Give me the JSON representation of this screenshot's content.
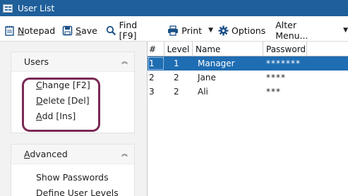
{
  "window": {
    "title": "User List"
  },
  "toolbar": {
    "notepad": {
      "prefix": "",
      "accel": "N",
      "rest": "otepad"
    },
    "save": {
      "prefix": "",
      "accel": "S",
      "rest": "ave"
    },
    "find": "Find [F9]",
    "print": "Print",
    "options": "Options",
    "alter_menu": "Alter Menu..."
  },
  "sidebar": {
    "users_panel": {
      "title": "Users",
      "items": [
        {
          "accel": "C",
          "rest": "hange [F2]"
        },
        {
          "accel": "D",
          "rest": "elete [Del]"
        },
        {
          "accel": "A",
          "rest": "dd [Ins]"
        }
      ]
    },
    "advanced_panel": {
      "title_accel": "A",
      "title_rest": "dvanced",
      "items": [
        "Show Passwords",
        "Define User Levels"
      ]
    }
  },
  "grid": {
    "columns": [
      "#",
      "Level",
      "Name",
      "Password"
    ],
    "rows": [
      {
        "num": "1",
        "level": "1",
        "name": "Manager",
        "password": "*******",
        "selected": true
      },
      {
        "num": "2",
        "level": "2",
        "name": "Jane",
        "password": "****",
        "selected": false
      },
      {
        "num": "3",
        "level": "2",
        "name": "Ali",
        "password": "***",
        "selected": false
      }
    ]
  },
  "colors": {
    "titlebar": "#1f5f9a",
    "selection": "#1f6db3",
    "highlight_outline": "#7a2955"
  },
  "icons": {
    "notepad": "notepad-icon",
    "save": "floppy-disk-icon",
    "find": "magnifier-icon",
    "print": "printer-icon",
    "options": "gear-icon"
  }
}
